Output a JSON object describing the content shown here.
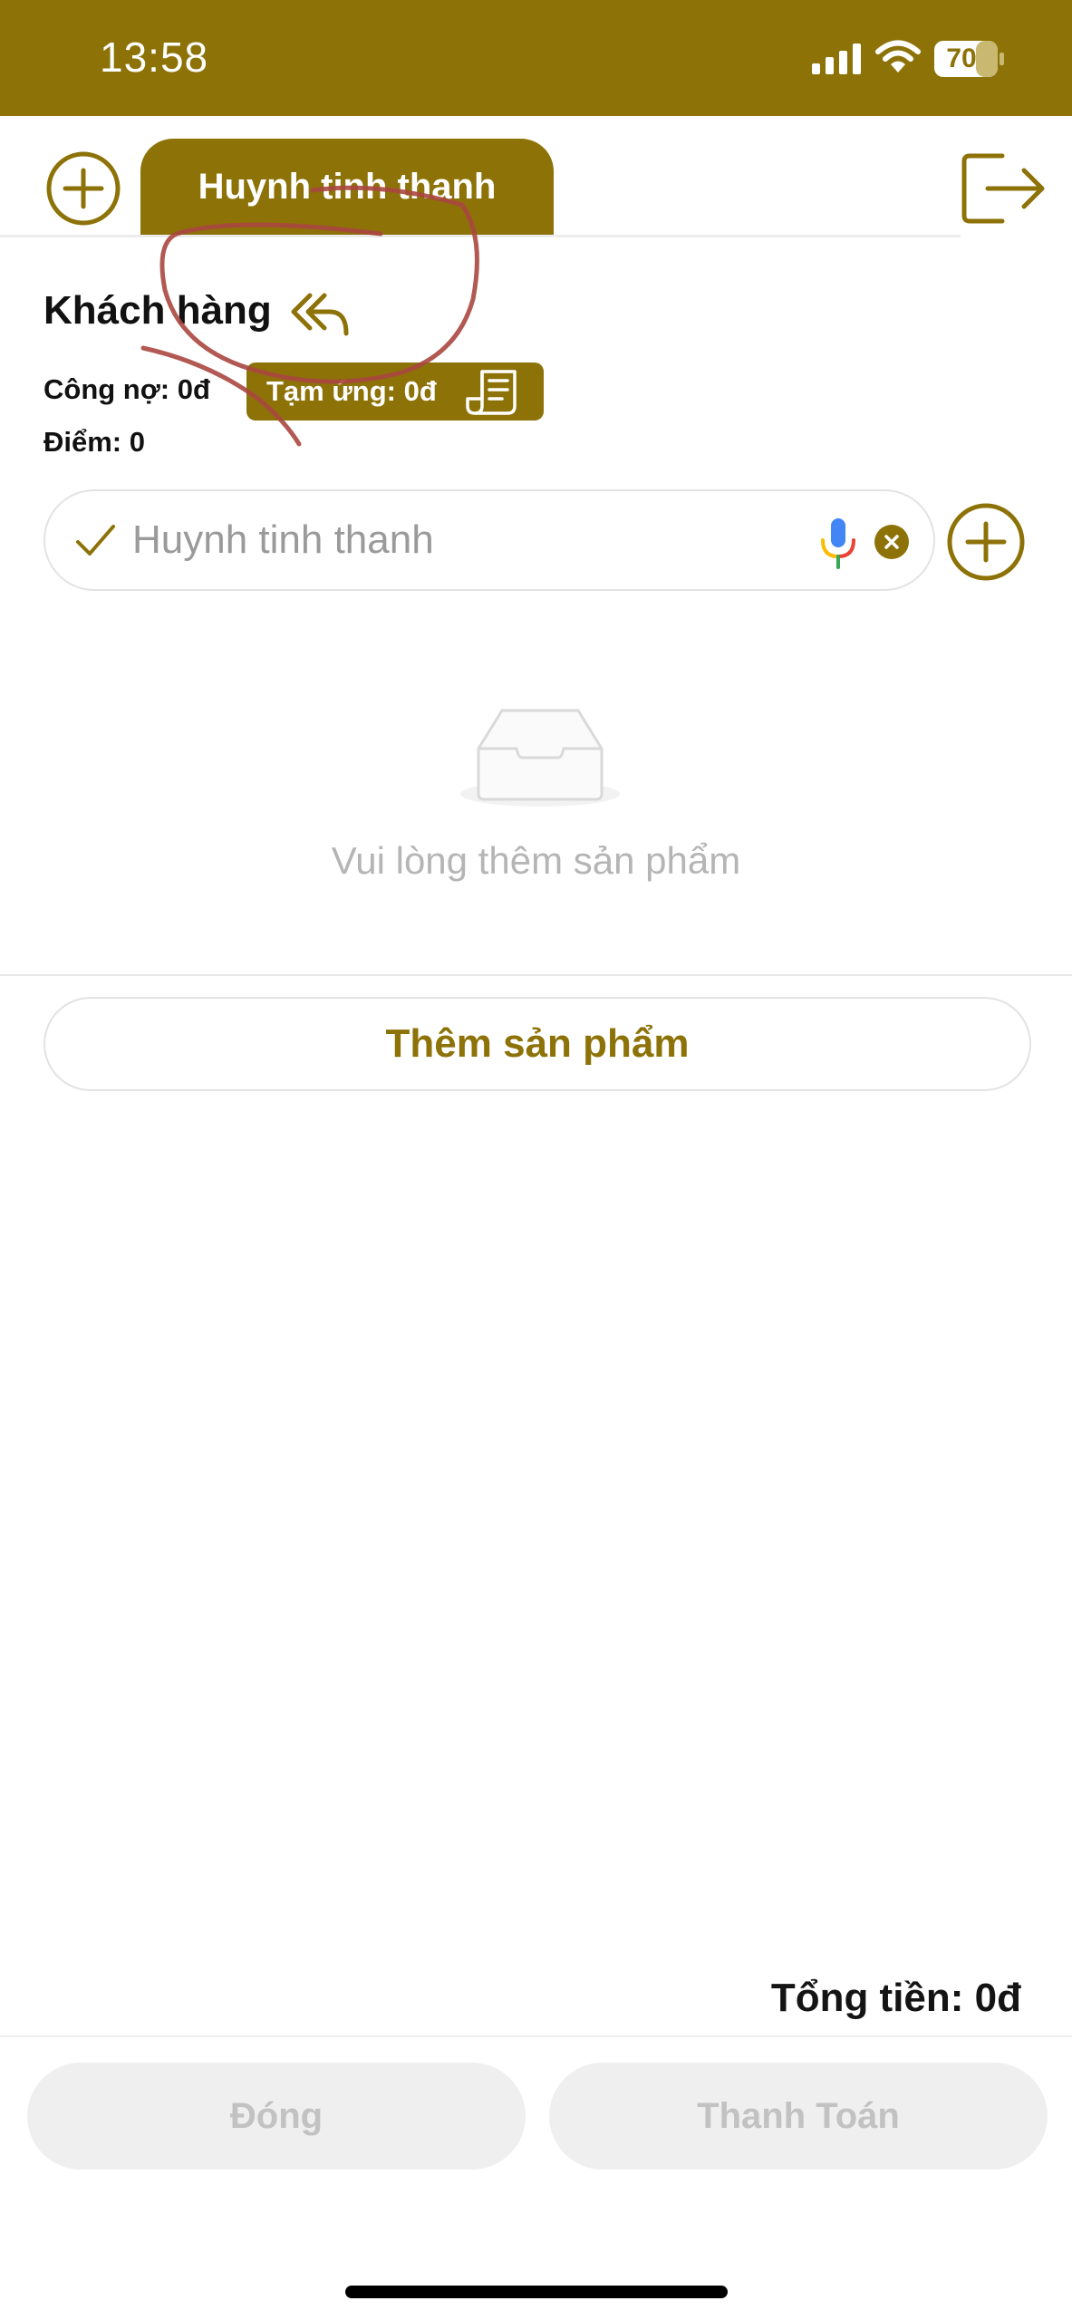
{
  "status_bar": {
    "time": "13:58",
    "battery": "70",
    "icons": [
      "signal-icon",
      "wifi-icon",
      "battery-icon"
    ]
  },
  "tabs": {
    "active_label": "Huynh tinh thanh",
    "add_icon": "plus-circle-icon",
    "logout_icon": "logout-icon"
  },
  "customer": {
    "title": "Khách hàng",
    "debt": "Công nợ: 0đ",
    "points": "Điểm: 0",
    "advance": "Tạm ứng: 0đ",
    "field_value": "Huynh tinh thanh"
  },
  "empty_state": {
    "message": "Vui lòng thêm sản phẩm"
  },
  "actions": {
    "add_product": "Thêm sản phẩm",
    "close": "Đóng",
    "pay": "Thanh Toán"
  },
  "total": {
    "label": "Tổng tiền: 0đ"
  },
  "colors": {
    "brand": "#8d7208",
    "annotation": "#a8473f",
    "disabled_bg": "#efefef"
  }
}
